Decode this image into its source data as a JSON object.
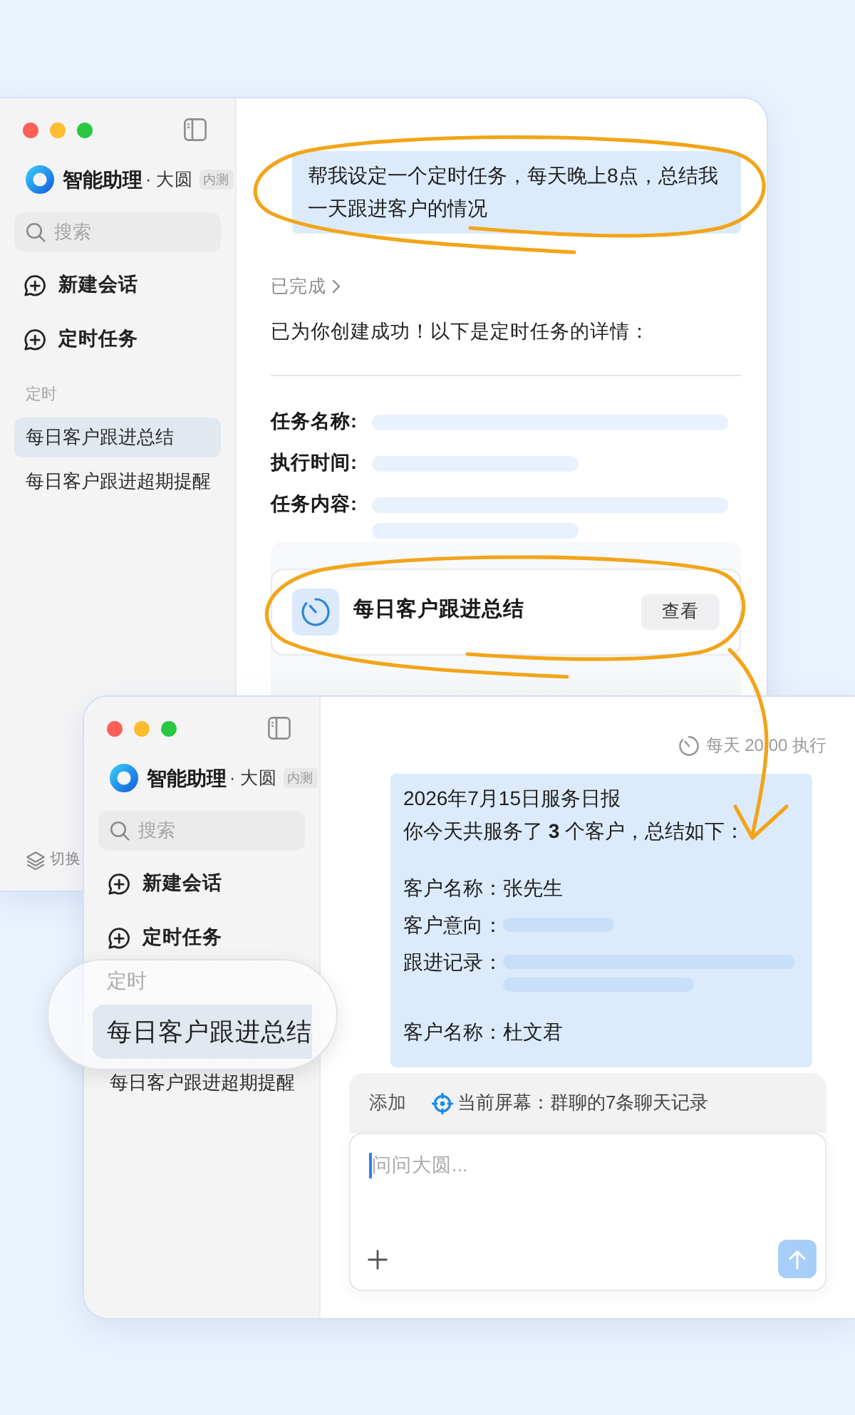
{
  "back_window": {
    "sidebar": {
      "app_name": "智能助理",
      "user": "· 大圆",
      "badge": "内测",
      "search": {
        "placeholder": "搜索"
      },
      "actions": [
        {
          "label": "新建会话"
        },
        {
          "label": "定时任务"
        }
      ],
      "section": "定时",
      "items": [
        {
          "label": "每日客户跟进总结",
          "selected": true
        },
        {
          "label": "每日客户跟进超期提醒",
          "selected": false
        }
      ],
      "footer": "切换"
    },
    "chat": {
      "user_message": {
        "text": "帮我设定一个定时任务，每天晚上8点，总结我一天跟进客户的情况",
        "circled": true
      },
      "status": "已完成",
      "reply": "已为你创建成功！以下是定时任务的详情：",
      "details": [
        {
          "label": "任务名称:",
          "kind": "wide"
        },
        {
          "label": "执行时间:",
          "kind": "narrow"
        },
        {
          "label": "任务内容:",
          "kind": "double"
        }
      ],
      "task_card": {
        "title": "每日客户跟进总结",
        "button": "查看",
        "circled": true,
        "arrow": true
      }
    }
  },
  "front_window": {
    "sidebar": {
      "app_name": "智能助理",
      "user": "· 大圆",
      "badge": "内测",
      "search": {
        "placeholder": "搜索"
      },
      "actions": [
        {
          "label": "新建会话"
        },
        {
          "label": "定时任务"
        }
      ],
      "section": "定时",
      "items": [
        {
          "label": "每日客户跟进总结",
          "selected": true
        },
        {
          "label": "每日客户跟进超期提醒",
          "selected": false
        }
      ],
      "magnifier": true
    },
    "chat": {
      "schedule": "每天 20:00 执行",
      "report": {
        "title": "2026年7月15日服务日报",
        "summary": "你今天共服务了 **3** 个客户，总结如下：",
        "customers": [
          {
            "fields": [
              {
                "label": "客户名称：",
                "value": "张先生",
                "kind": "text"
              },
              {
                "label": "客户意向：",
                "kind": "narrow"
              },
              {
                "label": "跟进记录：",
                "kind": "double"
              }
            ]
          },
          {
            "fields": [
              {
                "label": "客户名称：",
                "value": "杜文君",
                "kind": "text"
              }
            ]
          }
        ]
      },
      "composer": {
        "add": "添加",
        "context": "当前屏幕：群聊的7条聊天记录",
        "placeholder": "问问大圆..."
      }
    }
  }
}
